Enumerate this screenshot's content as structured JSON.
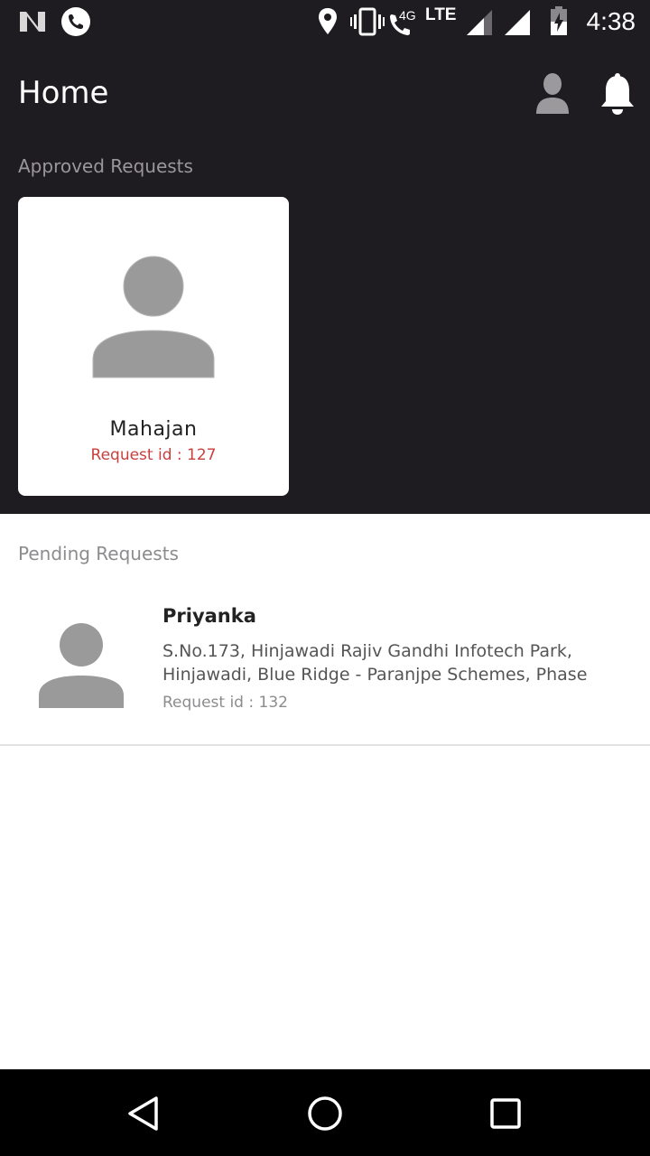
{
  "status_bar": {
    "time": "4:38",
    "network": "LTE",
    "network_small": "4G",
    "icons": [
      "n-logo-icon",
      "phone-app-icon",
      "location-icon",
      "vibrate-icon",
      "wifi-call-icon",
      "signal-icon",
      "signal-full-icon",
      "battery-charging-icon"
    ]
  },
  "app_bar": {
    "title": "Home",
    "icons": [
      "profile-icon",
      "bell-icon"
    ]
  },
  "approved": {
    "section_label": "Approved Requests",
    "cards": [
      {
        "name": "Mahajan",
        "request_id": "Request id : 127"
      }
    ]
  },
  "pending": {
    "section_label": "Pending Requests",
    "items": [
      {
        "name": "Priyanka",
        "address_line1": "S.No.173, Hinjawadi Rajiv Gandhi Infotech Park,",
        "address_line2": "Hinjawadi, Blue Ridge - Paranjpe Schemes, Phase",
        "request_id": "Request id : 132"
      }
    ]
  },
  "nav_bar": {
    "icons": [
      "back-icon",
      "home-icon",
      "recents-icon"
    ]
  },
  "colors": {
    "dark_bg": "#1f1c21",
    "accent_red": "#c9403d",
    "avatar_gray": "#9a9a9a"
  }
}
